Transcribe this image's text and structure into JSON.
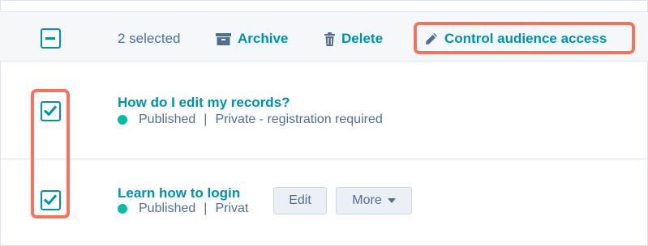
{
  "toolbar": {
    "selected_count": "2 selected",
    "archive_label": "Archive",
    "delete_label": "Delete",
    "control_label": "Control audience access"
  },
  "rows": [
    {
      "title": "How do I edit my records?",
      "status": "Published",
      "access": "Private - registration required",
      "checked": true
    },
    {
      "title": "Learn how to login",
      "status": "Published",
      "access": "Private",
      "checked": true,
      "edit_label": "Edit",
      "more_label": "More"
    }
  ],
  "colors": {
    "accent": "#0091ae",
    "highlight": "#f2745f",
    "status_published": "#00bda5"
  }
}
